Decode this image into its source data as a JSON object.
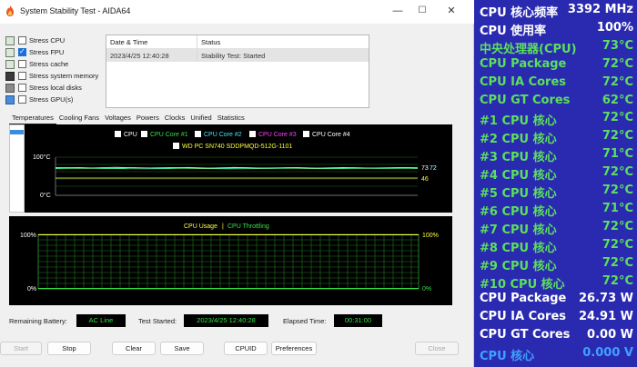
{
  "window": {
    "title": "System Stability Test - AIDA64",
    "controls": {
      "minimize": "—",
      "maximize": "☐",
      "close": "✕"
    }
  },
  "stress_options": [
    {
      "label": "Stress CPU",
      "checked": false,
      "icon": "cpu-icon"
    },
    {
      "label": "Stress FPU",
      "checked": true,
      "icon": "fpu-icon"
    },
    {
      "label": "Stress cache",
      "checked": false,
      "icon": "cache-icon"
    },
    {
      "label": "Stress system memory",
      "checked": false,
      "icon": "memory-icon"
    },
    {
      "label": "Stress local disks",
      "checked": false,
      "icon": "disk-icon"
    },
    {
      "label": "Stress GPU(s)",
      "checked": false,
      "icon": "gpu-icon"
    }
  ],
  "log": {
    "headers": [
      "Date & Time",
      "Status"
    ],
    "rows": [
      [
        "2023/4/25 12:40:28",
        "Stability Test: Started"
      ]
    ]
  },
  "tabs": [
    "Temperatures",
    "Cooling Fans",
    "Voltages",
    "Powers",
    "Clocks",
    "Unified",
    "Statistics"
  ],
  "temperature_chart": {
    "legend": [
      {
        "label": "CPU",
        "color": "#ffffff",
        "checked": true
      },
      {
        "label": "CPU Core #1",
        "color": "#38e04a",
        "checked": true
      },
      {
        "label": "CPU Core #2",
        "color": "#40e8ff",
        "checked": true
      },
      {
        "label": "CPU Core #3",
        "color": "#ff40ff",
        "checked": true
      },
      {
        "label": "CPU Core #4",
        "color": "#ffffff",
        "checked": true
      }
    ],
    "legend2": {
      "label": "WD PC SN740 SDDPMQD-512G-1101",
      "color": "#ffff40",
      "checked": true
    },
    "y_top": "100°C",
    "y_bottom": "0°C",
    "right_labels": [
      {
        "text": "73",
        "color": "#ffffff"
      },
      {
        "text": "72",
        "color": "#40e8ff"
      },
      {
        "text": "72",
        "color": "#ffffff"
      },
      {
        "text": "46",
        "color": "#ffff40"
      }
    ]
  },
  "usage_chart": {
    "title_a": "CPU Usage",
    "separator": "|",
    "title_b": "CPU Throttling",
    "y_top_left": "100%",
    "y_bottom_left": "0%",
    "y_top_right": "100%",
    "y_bottom_right": "0%"
  },
  "status": {
    "battery_label": "Remaining Battery:",
    "battery_value": "AC Line",
    "started_label": "Test Started:",
    "started_value": "2023/4/25 12:40:28",
    "elapsed_label": "Elapsed Time:",
    "elapsed_value": "00:31:00"
  },
  "buttons": {
    "start": "Start",
    "stop": "Stop",
    "clear": "Clear",
    "save": "Save",
    "cpuid": "CPUID",
    "preferences": "Preferences",
    "close": "Close"
  },
  "sensor_panel": [
    {
      "label": "CPU 核心频率",
      "value": "3392 MHz",
      "label_color": "#ffffff",
      "value_color": "#ffffff"
    },
    {
      "label": "CPU 使用率",
      "value": "100%",
      "label_color": "#ffffff",
      "value_color": "#ffffff"
    },
    {
      "label": "中央处理器(CPU)",
      "value": "73°C",
      "label_color": "#5ce05c",
      "value_color": "#5ce05c"
    },
    {
      "label": "CPU Package",
      "value": "72°C",
      "label_color": "#5ce05c",
      "value_color": "#5ce05c"
    },
    {
      "label": "CPU IA Cores",
      "value": "72°C",
      "label_color": "#5ce05c",
      "value_color": "#5ce05c"
    },
    {
      "label": "CPU GT Cores",
      "value": "62°C",
      "label_color": "#5ce05c",
      "value_color": "#5ce05c"
    },
    {
      "label": " #1 CPU 核心",
      "value": "72°C",
      "label_color": "#5ce05c",
      "value_color": "#5ce05c"
    },
    {
      "label": " #2 CPU 核心",
      "value": "72°C",
      "label_color": "#5ce05c",
      "value_color": "#5ce05c"
    },
    {
      "label": " #3 CPU 核心",
      "value": "71°C",
      "label_color": "#5ce05c",
      "value_color": "#5ce05c"
    },
    {
      "label": " #4 CPU 核心",
      "value": "72°C",
      "label_color": "#5ce05c",
      "value_color": "#5ce05c"
    },
    {
      "label": " #5 CPU 核心",
      "value": "72°C",
      "label_color": "#5ce05c",
      "value_color": "#5ce05c"
    },
    {
      "label": " #6 CPU 核心",
      "value": "71°C",
      "label_color": "#5ce05c",
      "value_color": "#5ce05c"
    },
    {
      "label": " #7 CPU 核心",
      "value": "72°C",
      "label_color": "#5ce05c",
      "value_color": "#5ce05c"
    },
    {
      "label": " #8 CPU 核心",
      "value": "72°C",
      "label_color": "#5ce05c",
      "value_color": "#5ce05c"
    },
    {
      "label": " #9 CPU 核心",
      "value": "72°C",
      "label_color": "#5ce05c",
      "value_color": "#5ce05c"
    },
    {
      "label": " #10 CPU 核心",
      "value": "72°C",
      "label_color": "#5ce05c",
      "value_color": "#5ce05c"
    },
    {
      "label": "CPU Package",
      "value": "26.73 W",
      "label_color": "#ffffff",
      "value_color": "#ffffff"
    },
    {
      "label": "CPU IA Cores",
      "value": "24.91 W",
      "label_color": "#ffffff",
      "value_color": "#ffffff"
    },
    {
      "label": "CPU GT Cores",
      "value": "0.00 W",
      "label_color": "#ffffff",
      "value_color": "#ffffff"
    },
    {
      "label": "CPU 核心",
      "value": "0.000 V",
      "label_color": "#40a0ff",
      "value_color": "#40a0ff"
    }
  ]
}
